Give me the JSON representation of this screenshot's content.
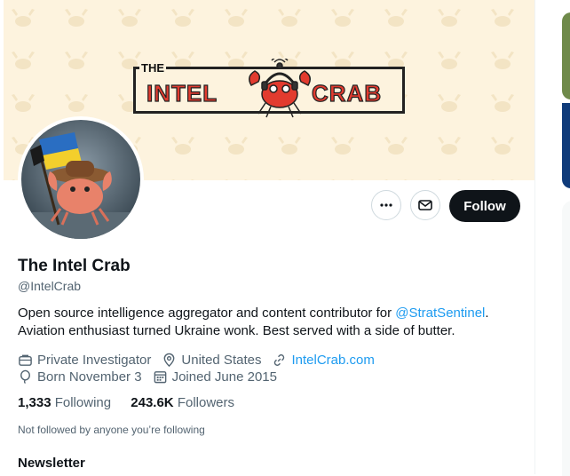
{
  "banner": {
    "logo_the": "THE",
    "logo_word_left": "INTEL",
    "logo_word_right": "CRAB"
  },
  "actions": {
    "more_icon": "more-horizontal-icon",
    "message_icon": "envelope-icon",
    "follow_label": "Follow"
  },
  "profile": {
    "display_name": "The Intel Crab",
    "handle": "@IntelCrab",
    "bio_part1": "Open source intelligence aggregator and content contributor for ",
    "bio_mention": "@StratSentinel",
    "bio_part2": ". Aviation enthusiast turned Ukraine wonk. Best served with a side of butter."
  },
  "meta": {
    "profession": "Private Investigator",
    "location": "United States",
    "website": "IntelCrab.com",
    "birthday": "Born November 3",
    "joined": "Joined June 2015"
  },
  "counts": {
    "following_value": "1,333",
    "following_label": "Following",
    "followers_value": "243.6K",
    "followers_label": "Followers"
  },
  "not_followed_text": "Not followed by anyone you’re following",
  "newsletter_label": "Newsletter",
  "colors": {
    "link": "#1d9bf0",
    "secondary_text": "#536471",
    "banner_bg": "#fdf3de",
    "crab_red": "#e23b2f"
  }
}
